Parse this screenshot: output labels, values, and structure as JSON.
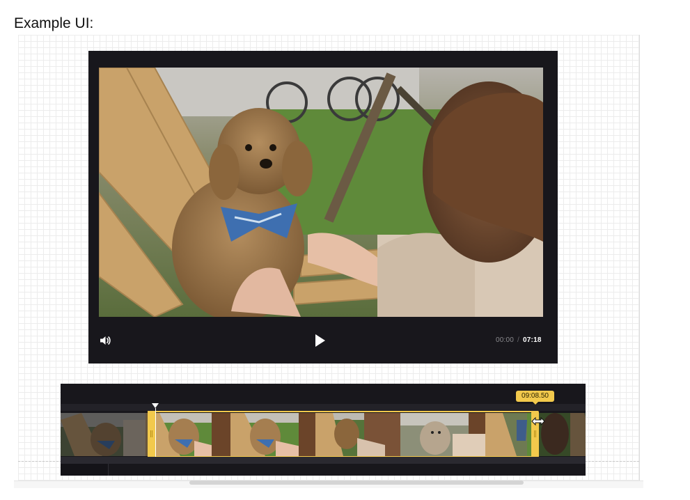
{
  "page": {
    "heading": "Example UI:"
  },
  "player": {
    "icons": {
      "volume": "speaker-icon",
      "play": "play-icon"
    },
    "current_time": "00:00",
    "separator": "/",
    "total_time": "07:18"
  },
  "timeline": {
    "trim_tooltip": "09:08.50",
    "icons": {
      "resize_cursor": "horizontal-resize-cursor-icon",
      "playhead": "playhead-marker-icon"
    }
  },
  "colors": {
    "player_background": "#18171c",
    "trim_accent": "#f2c94c"
  }
}
